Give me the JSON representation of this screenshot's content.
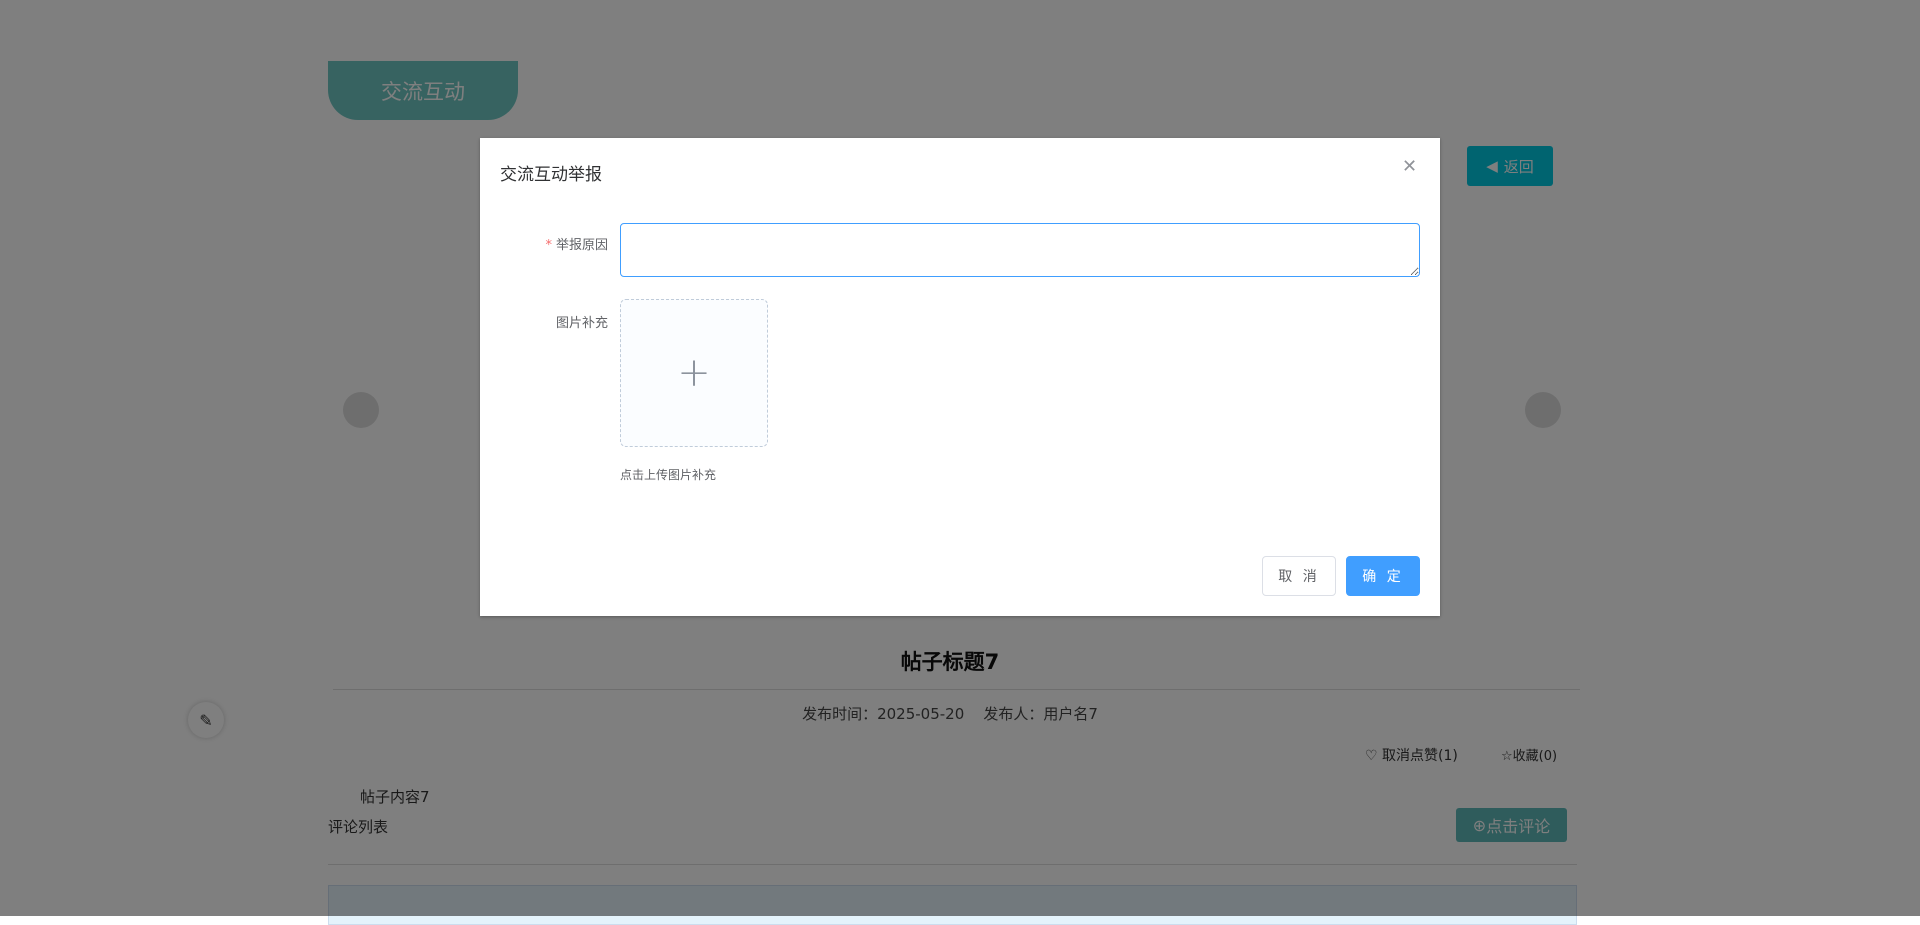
{
  "page": {
    "tab_label": "交流互动",
    "back_label": "返回",
    "post_title": "帖子标题7",
    "publish_time_label": "发布时间：",
    "publish_time": "2025-05-20",
    "publisher_label": "发布人：",
    "publisher": "用户名7",
    "like_label": "取消点赞(1)",
    "favorite_label": "收藏(0)",
    "content": "帖子内容7",
    "comment_list_label": "评论列表",
    "comment_button": "点击评论"
  },
  "dialog": {
    "title": "交流互动举报",
    "reason_label": "举报原因",
    "reason_value": "",
    "image_label": "图片补充",
    "upload_hint": "点击上传图片补充",
    "cancel_label": "取 消",
    "confirm_label": "确 定"
  },
  "colors": {
    "primary": "#409eff",
    "teal": "#6fc7c3"
  }
}
